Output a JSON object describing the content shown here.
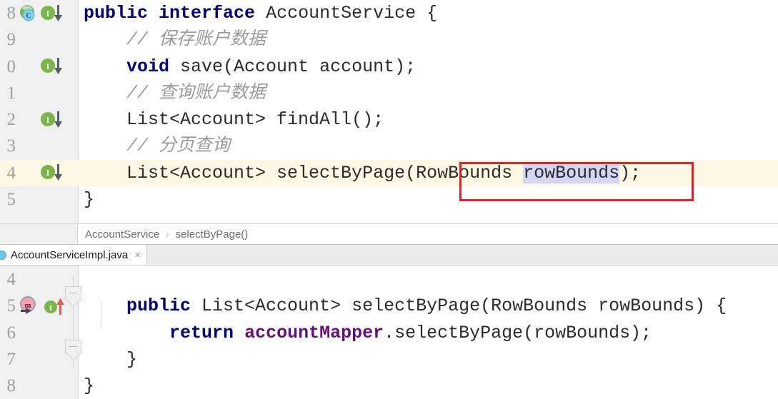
{
  "app": {
    "theme_accent": "#000080",
    "field_color": "#660e7a",
    "comment_color": "#9b9b9b",
    "current_line_bg": "#fcf8e4",
    "selection_bg": "#d5d5f5",
    "annotation_color": "#ee1c25",
    "gutter_bg": "#f0f0f0"
  },
  "top_editor": {
    "name": "AccountService",
    "lines": [
      {
        "number": "8",
        "gutter_icons": [
          "implemented-by-icon",
          "implementation-down-icon"
        ],
        "segments": [
          {
            "text": "public",
            "style": "kw"
          },
          {
            "text": " ",
            "style": "plain"
          },
          {
            "text": "interface",
            "style": "kw"
          },
          {
            "text": " AccountService {",
            "style": "plain"
          }
        ]
      },
      {
        "number": "9",
        "gutter_icons": [],
        "segments": [
          {
            "text": "    ",
            "style": "plain"
          },
          {
            "text": "// 保存账户数据",
            "style": "cmt"
          }
        ]
      },
      {
        "number": "0",
        "gutter_icons": [
          "implementation-down-icon"
        ],
        "segments": [
          {
            "text": "    ",
            "style": "plain"
          },
          {
            "text": "void",
            "style": "kw"
          },
          {
            "text": " save(Account account);",
            "style": "plain"
          }
        ]
      },
      {
        "number": "1",
        "gutter_icons": [],
        "segments": [
          {
            "text": "    ",
            "style": "plain"
          },
          {
            "text": "// 查询账户数据",
            "style": "cmt"
          }
        ]
      },
      {
        "number": "2",
        "gutter_icons": [
          "implementation-down-icon"
        ],
        "segments": [
          {
            "text": "    List<Account> findAll();",
            "style": "plain"
          }
        ]
      },
      {
        "number": "3",
        "gutter_icons": [],
        "segments": [
          {
            "text": "    ",
            "style": "plain"
          },
          {
            "text": "// 分页查询",
            "style": "cmt"
          }
        ]
      },
      {
        "number": "4",
        "gutter_icons": [
          "implementation-down-icon"
        ],
        "highlight": true,
        "segments": [
          {
            "text": "    List<Account> selectByPage(RowBounds ",
            "style": "plain"
          },
          {
            "text": "rowBounds",
            "style": "sel"
          },
          {
            "text": ");",
            "style": "plain"
          }
        ]
      },
      {
        "number": "5",
        "gutter_icons": [],
        "segments": [
          {
            "text": "}",
            "style": "plain"
          }
        ]
      }
    ]
  },
  "breadcrumb": {
    "items": [
      "AccountService",
      "selectByPage()"
    ],
    "separator": "›"
  },
  "tab_bar": {
    "tabs": [
      {
        "label": "AccountServiceImpl.java",
        "close": "×",
        "icon": "java-class-icon",
        "active": true
      }
    ]
  },
  "bottom_editor": {
    "name": "AccountServiceImpl",
    "lines": [
      {
        "number": "4",
        "gutter_icons": [],
        "segments": [
          {
            "text": "",
            "style": "plain"
          }
        ]
      },
      {
        "number": "5",
        "gutter_icons": [
          "overriding-method-icon",
          "implementing-up-icon"
        ],
        "fold": "collapse-marker",
        "segments": [
          {
            "text": "    ",
            "style": "plain"
          },
          {
            "text": "public",
            "style": "kw"
          },
          {
            "text": " List<Account> selectByPage(RowBounds rowBounds) {",
            "style": "plain"
          }
        ]
      },
      {
        "number": "6",
        "gutter_icons": [],
        "segments": [
          {
            "text": "        ",
            "style": "plain"
          },
          {
            "text": "return",
            "style": "kw"
          },
          {
            "text": " ",
            "style": "plain"
          },
          {
            "text": "accountMapper",
            "style": "fld"
          },
          {
            "text": ".selectByPage(rowBounds);",
            "style": "plain"
          }
        ]
      },
      {
        "number": "7",
        "gutter_icons": [],
        "fold": "collapse-marker",
        "segments": [
          {
            "text": "    }",
            "style": "plain"
          }
        ]
      },
      {
        "number": "8",
        "gutter_icons": [],
        "segments": [
          {
            "text": "}",
            "style": "plain"
          }
        ]
      }
    ]
  },
  "annotation": {
    "shape": "rectangle",
    "color": "#ee1c25",
    "target_text": "RowBounds rowBounds"
  }
}
